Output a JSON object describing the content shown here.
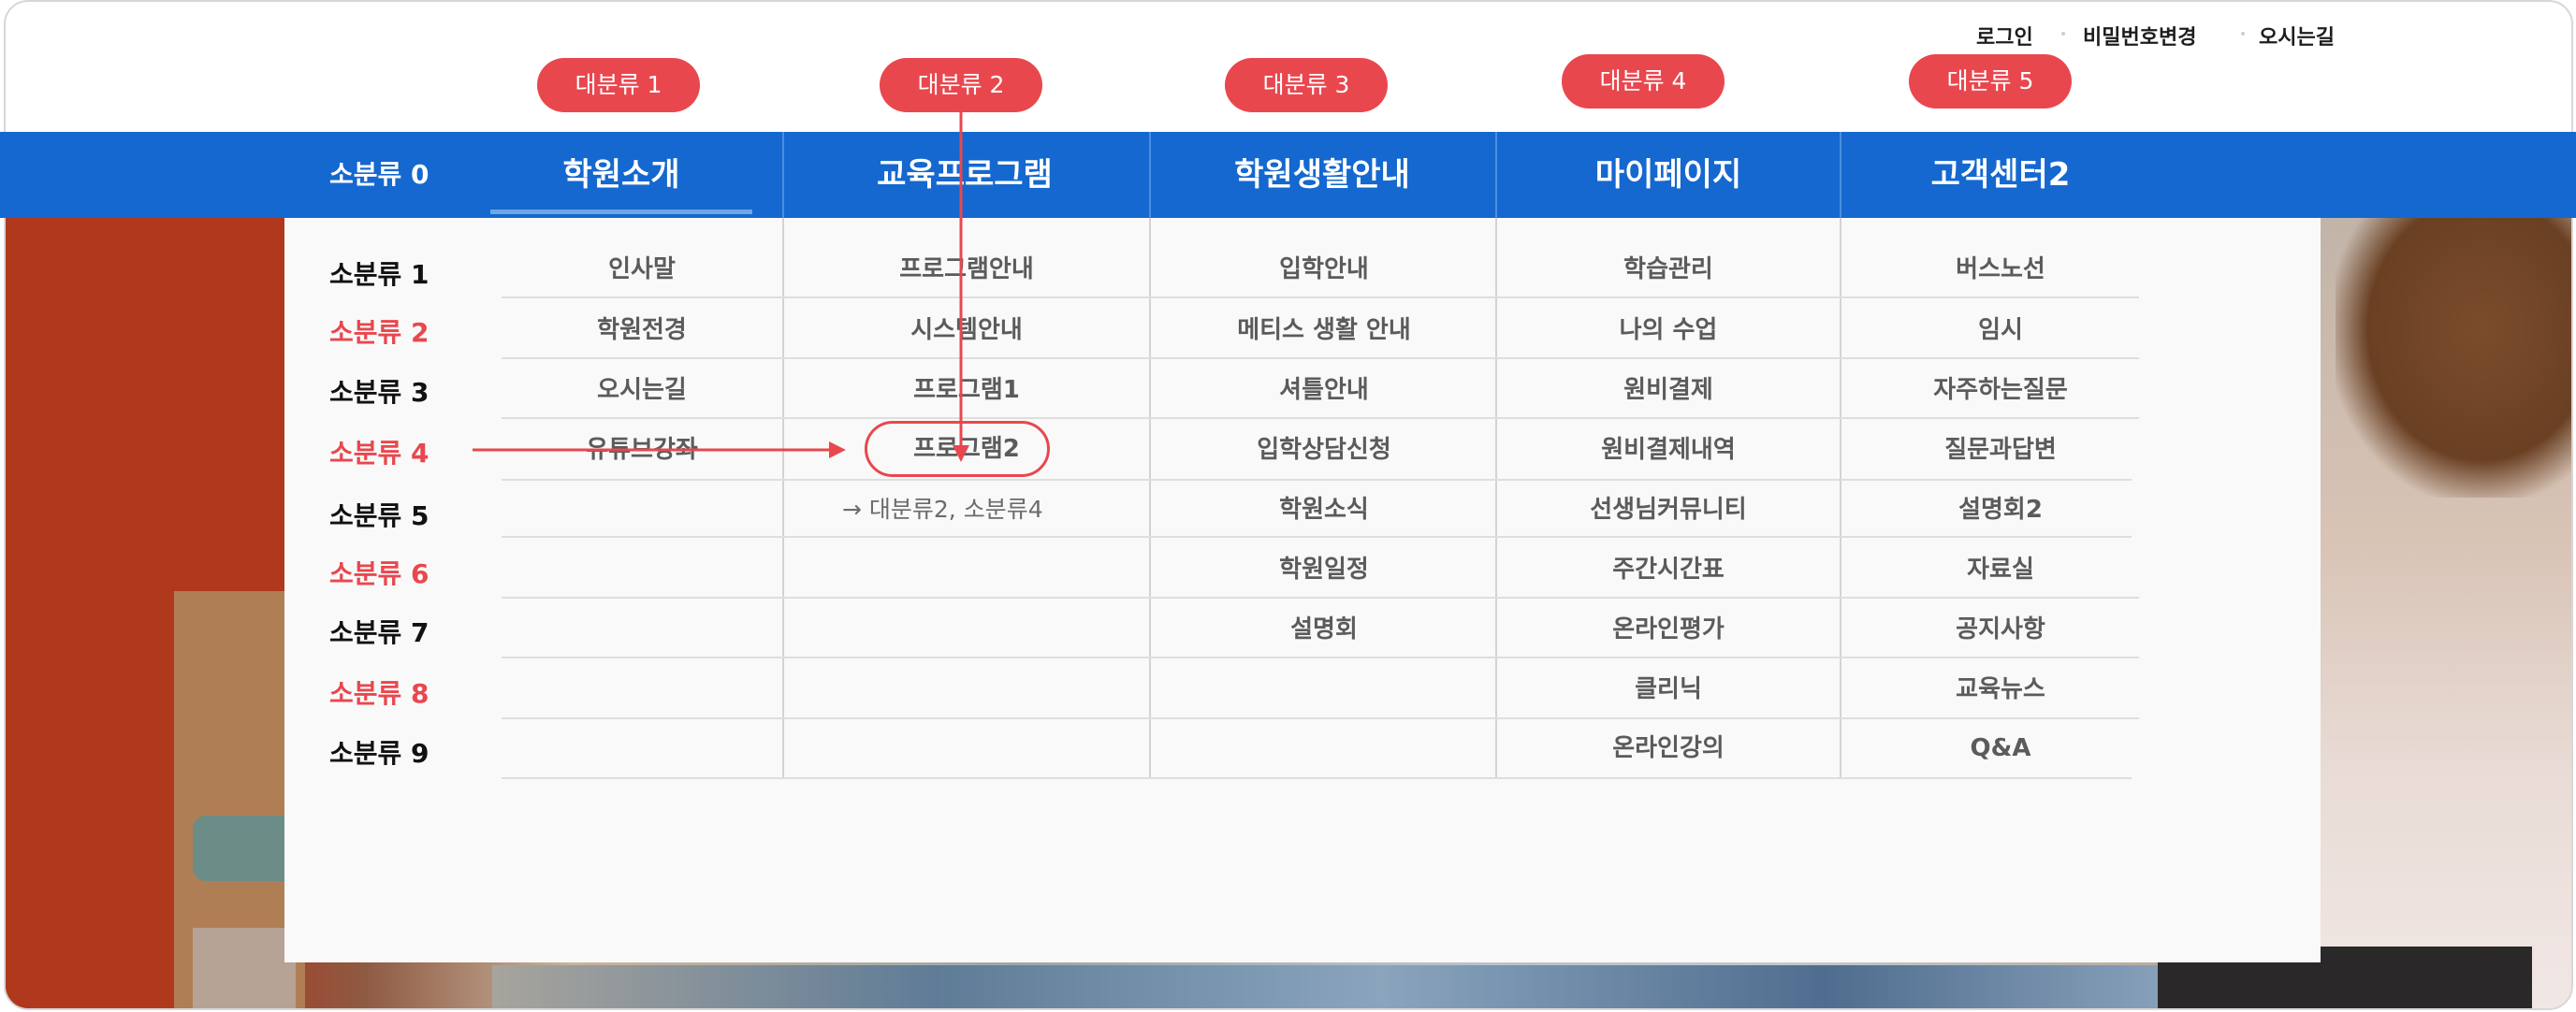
{
  "utility_links": {
    "login": "로그인",
    "change_password": "비밀번호변경",
    "directions": "오시는길"
  },
  "annotation_pills": [
    "대분류 1",
    "대분류 2",
    "대분류 3",
    "대분류 4",
    "대분류 5"
  ],
  "nav": {
    "sub0_label": "소분류 0",
    "categories": [
      "학원소개",
      "교육프로그램",
      "학원생활안내",
      "마이페이지",
      "고객센터2"
    ]
  },
  "sub_labels": [
    "소분류 1",
    "소분류 2",
    "소분류 3",
    "소분류 4",
    "소분류 5",
    "소분류 6",
    "소분류 7",
    "소분류 8",
    "소분류 9"
  ],
  "columns": [
    {
      "items": [
        "인사말",
        "학원전경",
        "오시는길",
        "유튜브강좌"
      ]
    },
    {
      "items": [
        "프로그램안내",
        "시스템안내",
        "프로그램1",
        "프로그램2"
      ]
    },
    {
      "items": [
        "입학안내",
        "메티스 생활 안내",
        "셔틀안내",
        "입학상담신청",
        "학원소식",
        "학원일정",
        "설명회"
      ]
    },
    {
      "items": [
        "학습관리",
        "나의 수업",
        "원비결제",
        "원비결제내역",
        "선생님커뮤니티",
        "주간시간표",
        "온라인평가",
        "클리닉",
        "온라인강의"
      ]
    },
    {
      "items": [
        "버스노선",
        "임시",
        "자주하는질문",
        "질문과답변",
        "설명회2",
        "자료실",
        "공지사항",
        "교육뉴스",
        "Q&A"
      ]
    }
  ],
  "annotation_note": "→ 대분류2, 소분류4",
  "colors": {
    "nav_blue": "#1568cf",
    "accent_red": "#e9474e",
    "panel_bg": "#f9f9f9"
  }
}
